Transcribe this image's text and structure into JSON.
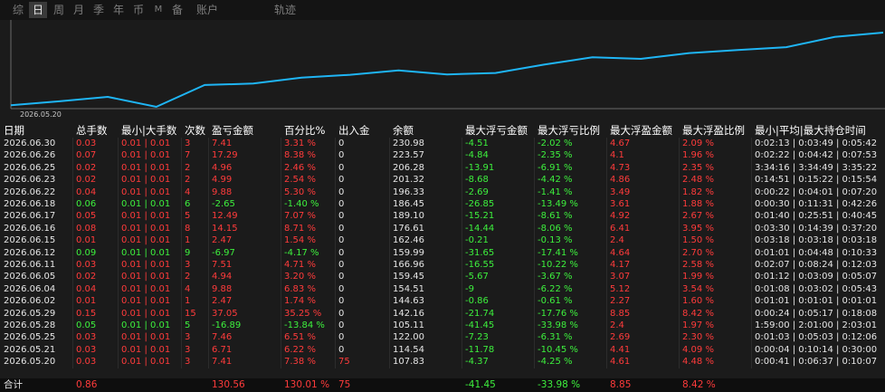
{
  "colors": {
    "red": "#ff3b3b",
    "green": "#3df03d",
    "white": "#e6e6e6",
    "line": "#1fb5f5",
    "bg": "#1b1b1b"
  },
  "tabs": [
    {
      "label": "综",
      "active": false
    },
    {
      "label": "日",
      "active": true
    },
    {
      "label": "周",
      "active": false
    },
    {
      "label": "月",
      "active": false
    },
    {
      "label": "季",
      "active": false
    },
    {
      "label": "年",
      "active": false
    },
    {
      "label": "币",
      "active": false
    },
    {
      "label": "M",
      "active": false
    },
    {
      "label": "备",
      "active": false
    },
    {
      "label": "账户",
      "active": false
    },
    {
      "label": "轨迹",
      "active": false
    }
  ],
  "chart_data": {
    "type": "line",
    "x_first_label": "2026.05.20",
    "x": [
      "2026.05.20",
      "2026.05.21",
      "2026.05.25",
      "2026.05.28",
      "2026.05.29",
      "2026.06.02",
      "2026.06.04",
      "2026.06.05",
      "2026.06.11",
      "2026.06.12",
      "2026.06.15",
      "2026.06.16",
      "2026.06.17",
      "2026.06.18",
      "2026.06.22",
      "2026.06.23",
      "2026.06.25",
      "2026.06.26",
      "2026.06.30"
    ],
    "y": [
      107.83,
      114.54,
      122.0,
      105.11,
      142.16,
      144.63,
      154.51,
      159.45,
      166.96,
      159.99,
      162.46,
      176.61,
      189.1,
      186.45,
      196.33,
      201.32,
      206.28,
      223.57,
      230.98
    ]
  },
  "table": {
    "headers": [
      "日期",
      "总手数",
      "最小|大手数",
      "次数",
      "盈亏金额",
      "百分比%",
      "出入金",
      "余额",
      "最大浮亏金额",
      "最大浮亏比例",
      "最大浮盈金额",
      "最大浮盈比例",
      "最小|平均|最大持仓时间"
    ],
    "rows": [
      {
        "date": "2026.06.30",
        "lots": "0.03",
        "minmax": "0.01 | 0.01",
        "count": "3",
        "pnl": "7.41",
        "pct": "3.31 %",
        "dep": "0",
        "bal": "230.98",
        "mfl": "-4.51",
        "mflp": "-2.02 %",
        "mfp": "4.67",
        "mfpp": "2.09 %",
        "hold": "0:02:13 | 0:03:49 | 0:05:42",
        "c": "r"
      },
      {
        "date": "2026.06.26",
        "lots": "0.07",
        "minmax": "0.01 | 0.01",
        "count": "7",
        "pnl": "17.29",
        "pct": "8.38 %",
        "dep": "0",
        "bal": "223.57",
        "mfl": "-4.84",
        "mflp": "-2.35 %",
        "mfp": "4.1",
        "mfpp": "1.96 %",
        "hold": "0:02:22 | 0:04:42 | 0:07:53",
        "c": "r"
      },
      {
        "date": "2026.06.25",
        "lots": "0.02",
        "minmax": "0.01 | 0.01",
        "count": "2",
        "pnl": "4.96",
        "pct": "2.46 %",
        "dep": "0",
        "bal": "206.28",
        "mfl": "-13.91",
        "mflp": "-6.91 %",
        "mfp": "4.73",
        "mfpp": "2.35 %",
        "hold": "3:34:16 | 3:34:49 | 3:35:22",
        "c": "r"
      },
      {
        "date": "2026.06.23",
        "lots": "0.02",
        "minmax": "0.01 | 0.01",
        "count": "2",
        "pnl": "4.99",
        "pct": "2.54 %",
        "dep": "0",
        "bal": "201.32",
        "mfl": "-8.68",
        "mflp": "-4.42 %",
        "mfp": "4.86",
        "mfpp": "2.48 %",
        "hold": "0:14:51 | 0:15:22 | 0:15:54",
        "c": "r"
      },
      {
        "date": "2026.06.22",
        "lots": "0.04",
        "minmax": "0.01 | 0.01",
        "count": "4",
        "pnl": "9.88",
        "pct": "5.30 %",
        "dep": "0",
        "bal": "196.33",
        "mfl": "-2.69",
        "mflp": "-1.41 %",
        "mfp": "3.49",
        "mfpp": "1.82 %",
        "hold": "0:00:22 | 0:04:01 | 0:07:20",
        "c": "r"
      },
      {
        "date": "2026.06.18",
        "lots": "0.06",
        "minmax": "0.01 | 0.01",
        "count": "6",
        "pnl": "-2.65",
        "pct": "-1.40 %",
        "dep": "0",
        "bal": "186.45",
        "mfl": "-26.85",
        "mflp": "-13.49 %",
        "mfp": "3.61",
        "mfpp": "1.88 %",
        "hold": "0:00:30 | 0:11:31 | 0:42:26",
        "c": "g"
      },
      {
        "date": "2026.06.17",
        "lots": "0.05",
        "minmax": "0.01 | 0.01",
        "count": "5",
        "pnl": "12.49",
        "pct": "7.07 %",
        "dep": "0",
        "bal": "189.10",
        "mfl": "-15.21",
        "mflp": "-8.61 %",
        "mfp": "4.92",
        "mfpp": "2.67 %",
        "hold": "0:01:40 | 0:25:51 | 0:40:45",
        "c": "r"
      },
      {
        "date": "2026.06.16",
        "lots": "0.08",
        "minmax": "0.01 | 0.01",
        "count": "8",
        "pnl": "14.15",
        "pct": "8.71 %",
        "dep": "0",
        "bal": "176.61",
        "mfl": "-14.44",
        "mflp": "-8.06 %",
        "mfp": "6.41",
        "mfpp": "3.95 %",
        "hold": "0:03:30 | 0:14:39 | 0:37:20",
        "c": "r"
      },
      {
        "date": "2026.06.15",
        "lots": "0.01",
        "minmax": "0.01 | 0.01",
        "count": "1",
        "pnl": "2.47",
        "pct": "1.54 %",
        "dep": "0",
        "bal": "162.46",
        "mfl": "-0.21",
        "mflp": "-0.13 %",
        "mfp": "2.4",
        "mfpp": "1.50 %",
        "hold": "0:03:18 | 0:03:18 | 0:03:18",
        "c": "r"
      },
      {
        "date": "2026.06.12",
        "lots": "0.09",
        "minmax": "0.01 | 0.01",
        "count": "9",
        "pnl": "-6.97",
        "pct": "-4.17 %",
        "dep": "0",
        "bal": "159.99",
        "mfl": "-31.65",
        "mflp": "-17.41 %",
        "mfp": "4.64",
        "mfpp": "2.70 %",
        "hold": "0:01:01 | 0:04:48 | 0:10:33",
        "c": "g"
      },
      {
        "date": "2026.06.11",
        "lots": "0.03",
        "minmax": "0.01 | 0.01",
        "count": "3",
        "pnl": "7.51",
        "pct": "4.71 %",
        "dep": "0",
        "bal": "166.96",
        "mfl": "-16.55",
        "mflp": "-10.22 %",
        "mfp": "4.17",
        "mfpp": "2.58 %",
        "hold": "0:02:07 | 0:08:24 | 0:12:03",
        "c": "r"
      },
      {
        "date": "2026.06.05",
        "lots": "0.02",
        "minmax": "0.01 | 0.01",
        "count": "2",
        "pnl": "4.94",
        "pct": "3.20 %",
        "dep": "0",
        "bal": "159.45",
        "mfl": "-5.67",
        "mflp": "-3.67 %",
        "mfp": "3.07",
        "mfpp": "1.99 %",
        "hold": "0:01:12 | 0:03:09 | 0:05:07",
        "c": "r"
      },
      {
        "date": "2026.06.04",
        "lots": "0.04",
        "minmax": "0.01 | 0.01",
        "count": "4",
        "pnl": "9.88",
        "pct": "6.83 %",
        "dep": "0",
        "bal": "154.51",
        "mfl": "-9",
        "mflp": "-6.22 %",
        "mfp": "5.12",
        "mfpp": "3.54 %",
        "hold": "0:01:08 | 0:03:02 | 0:05:43",
        "c": "r"
      },
      {
        "date": "2026.06.02",
        "lots": "0.01",
        "minmax": "0.01 | 0.01",
        "count": "1",
        "pnl": "2.47",
        "pct": "1.74 %",
        "dep": "0",
        "bal": "144.63",
        "mfl": "-0.86",
        "mflp": "-0.61 %",
        "mfp": "2.27",
        "mfpp": "1.60 %",
        "hold": "0:01:01 | 0:01:01 | 0:01:01",
        "c": "r"
      },
      {
        "date": "2026.05.29",
        "lots": "0.15",
        "minmax": "0.01 | 0.01",
        "count": "15",
        "pnl": "37.05",
        "pct": "35.25 %",
        "dep": "0",
        "bal": "142.16",
        "mfl": "-21.74",
        "mflp": "-17.76 %",
        "mfp": "8.85",
        "mfpp": "8.42 %",
        "hold": "0:00:24 | 0:05:17 | 0:18:08",
        "c": "r"
      },
      {
        "date": "2026.05.28",
        "lots": "0.05",
        "minmax": "0.01 | 0.01",
        "count": "5",
        "pnl": "-16.89",
        "pct": "-13.84 %",
        "dep": "0",
        "bal": "105.11",
        "mfl": "-41.45",
        "mflp": "-33.98 %",
        "mfp": "2.4",
        "mfpp": "1.97 %",
        "hold": "1:59:00 | 2:01:00 | 2:03:01",
        "c": "g"
      },
      {
        "date": "2026.05.25",
        "lots": "0.03",
        "minmax": "0.01 | 0.01",
        "count": "3",
        "pnl": "7.46",
        "pct": "6.51 %",
        "dep": "0",
        "bal": "122.00",
        "mfl": "-7.23",
        "mflp": "-6.31 %",
        "mfp": "2.69",
        "mfpp": "2.30 %",
        "hold": "0:01:03 | 0:05:03 | 0:12:06",
        "c": "r"
      },
      {
        "date": "2026.05.21",
        "lots": "0.03",
        "minmax": "0.01 | 0.01",
        "count": "3",
        "pnl": "6.71",
        "pct": "6.22 %",
        "dep": "0",
        "bal": "114.54",
        "mfl": "-11.78",
        "mflp": "-10.45 %",
        "mfp": "4.41",
        "mfpp": "4.09 %",
        "hold": "0:00:04 | 0:10:14 | 0:30:00",
        "c": "r"
      },
      {
        "date": "2026.05.20",
        "lots": "0.03",
        "minmax": "0.01 | 0.01",
        "count": "3",
        "pnl": "7.41",
        "pct": "7.38 %",
        "dep": "75",
        "bal": "107.83",
        "mfl": "-4.37",
        "mflp": "-4.25 %",
        "mfp": "4.61",
        "mfpp": "4.48 %",
        "hold": "0:00:41 | 0:06:37 | 0:10:07",
        "c": "r"
      }
    ],
    "total": {
      "label": "合计",
      "lots": "0.86",
      "pnl": "130.56",
      "pct": "130.01 %",
      "dep": "75",
      "mfl": "-41.45",
      "mflp": "-33.98 %",
      "mfp": "8.85",
      "mfpp": "8.42 %"
    }
  }
}
